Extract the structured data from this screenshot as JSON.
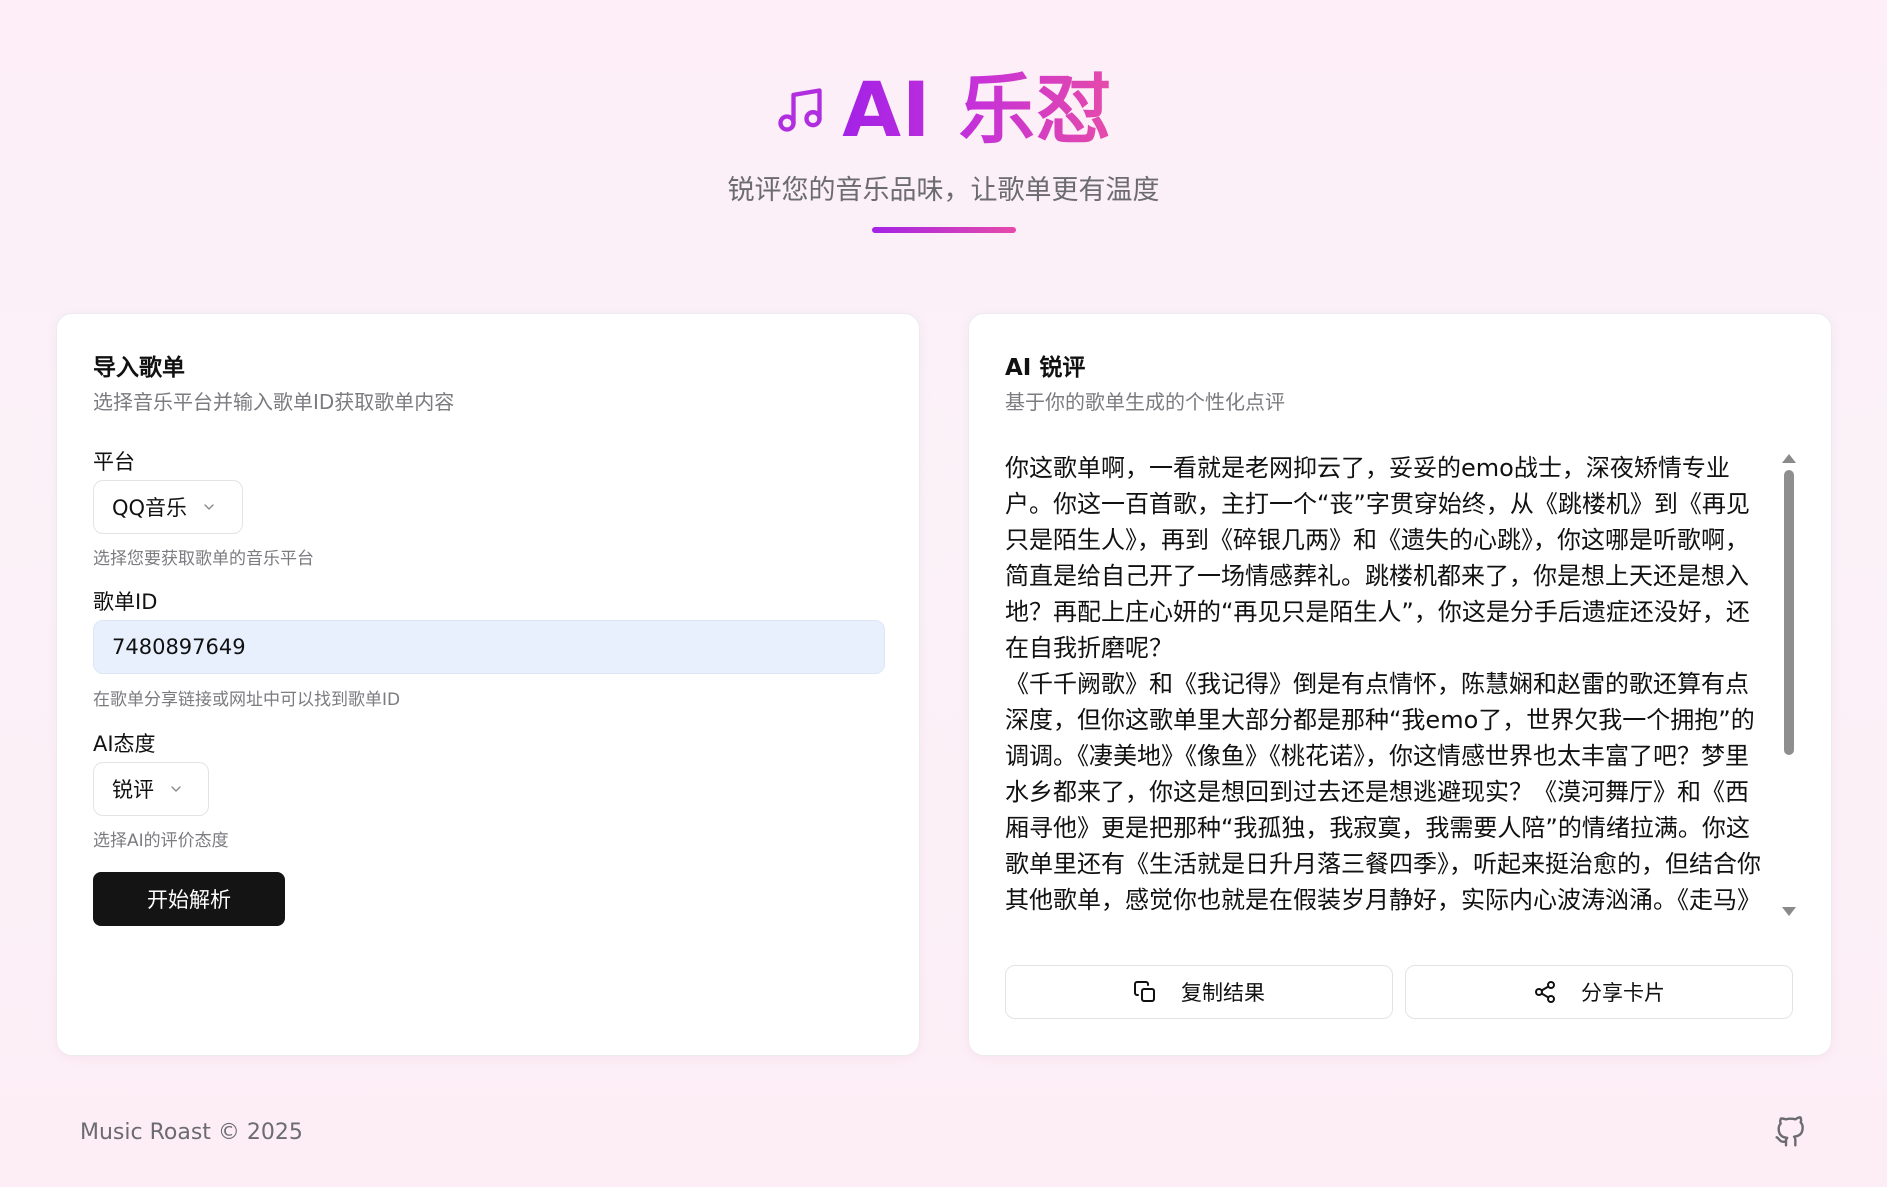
{
  "header": {
    "title": "AI 乐怼",
    "subtitle": "锐评您的音乐品味，让歌单更有温度",
    "icon": "music-note-icon",
    "accent_colors": [
      "#a322e6",
      "#e64ba9"
    ]
  },
  "import_card": {
    "title": "导入歌单",
    "description": "选择音乐平台并输入歌单ID获取歌单内容",
    "platform": {
      "label": "平台",
      "selected": "QQ音乐",
      "hint": "选择您要获取歌单的音乐平台"
    },
    "playlist_id": {
      "label": "歌单ID",
      "value": "7480897649",
      "hint": "在歌单分享链接或网址中可以找到歌单ID"
    },
    "attitude": {
      "label": "AI态度",
      "selected": "锐评",
      "hint": "选择AI的评价态度"
    },
    "submit_label": "开始解析"
  },
  "result_card": {
    "title": "AI 锐评",
    "description": "基于你的歌单生成的个性化点评",
    "text": "你这歌单啊，一看就是老网抑云了，妥妥的emo战士，深夜矫情专业户。你这一百首歌，主打一个“丧”字贯穿始终，从《跳楼机》到《再见只是陌生人》，再到《碎银几两》和《遗失的心跳》，你这哪是听歌啊，简直是给自己开了一场情感葬礼。跳楼机都来了，你是想上天还是想入地？再配上庄心妍的“再见只是陌生人”，你这是分手后遗症还没好，还在自我折磨呢？\n《千千阙歌》和《我记得》倒是有点情怀，陈慧娴和赵雷的歌还算有点深度，但你这歌单里大部分都是那种“我emo了，世界欠我一个拥抱”的调调。《凄美地》《像鱼》《桃花诺》，你这情感世界也太丰富了吧？梦里水乡都来了，你这是想回到过去还是想逃避现实？《漠河舞厅》和《西厢寻他》更是把那种“我孤独，我寂寞，我需要人陪”的情绪拉满。你这歌单里还有《生活就是日升月落三餐四季》，听起来挺治愈的，但结合你其他歌单，感觉你也就是在假装岁月静好，实际内心波涛汹涌。《走马》和《晨阳》更是把那种“我迷茫，我无助，我找不到方向”的情绪",
    "copy_label": "复制结果",
    "share_label": "分享卡片"
  },
  "footer": {
    "text": "Music Roast © 2025",
    "icon": "github-icon"
  }
}
